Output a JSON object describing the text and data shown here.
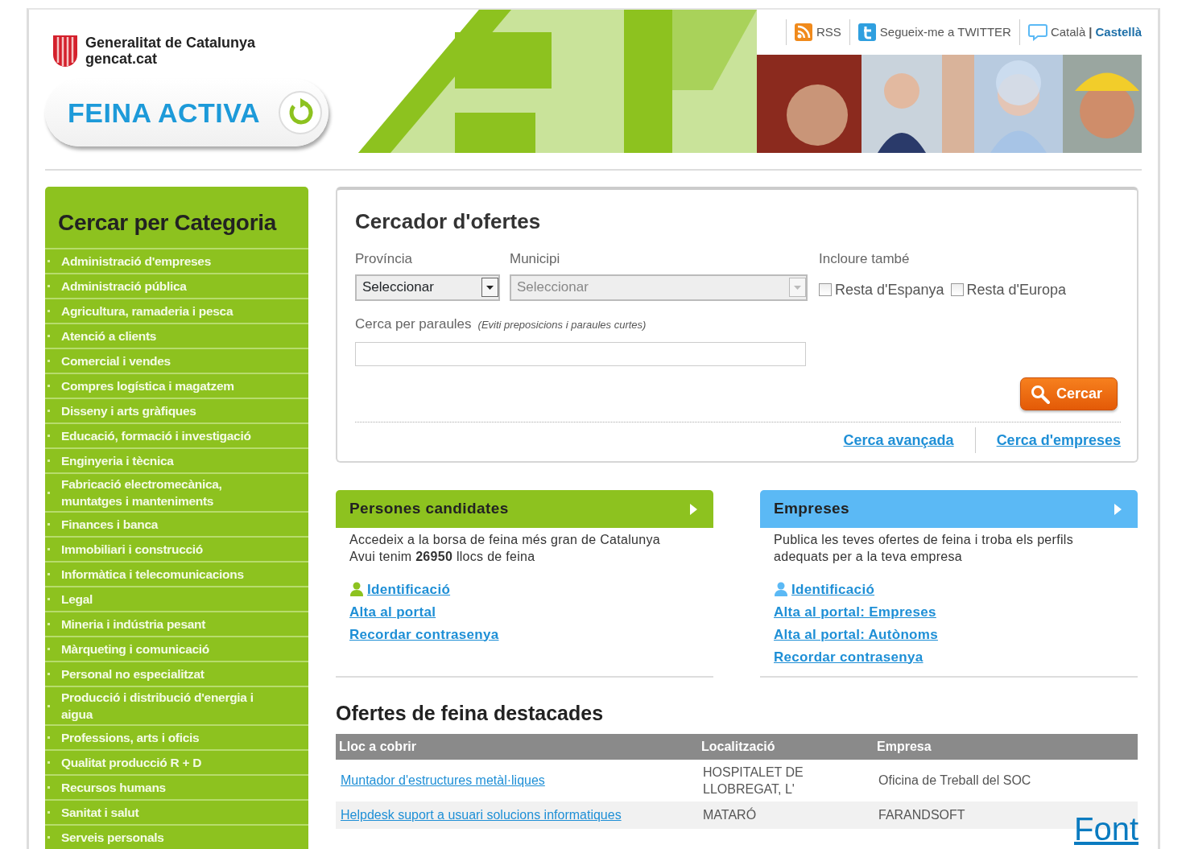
{
  "header": {
    "brand_name": "Generalitat de Catalunya",
    "brand_domain": "gencat.cat",
    "product": "FEINA ACTIVA",
    "links": [
      {
        "kind": "rss",
        "label": "RSS"
      },
      {
        "kind": "twitter",
        "label": "Segueix-me a TWITTER"
      }
    ],
    "languages": [
      {
        "label": "Català",
        "selected": false
      },
      {
        "label": "Castellà",
        "selected": true
      }
    ],
    "language_separator": "|"
  },
  "sidebar": {
    "title": "Cercar per Categoria",
    "items": [
      "Administració d'empreses",
      "Administració pública",
      "Agricultura, ramaderia i pesca",
      "Atenció a clients",
      "Comercial i vendes",
      "Compres logística i magatzem",
      "Disseny i arts gràfiques",
      "Educació, formació i investigació",
      "Enginyeria i tècnica",
      "Fabricació electromecànica, muntatges i manteniments",
      "Finances i banca",
      "Immobiliari i construcció",
      "Informàtica i telecomunicacions",
      "Legal",
      "Mineria i indústria pesant",
      "Màrqueting i comunicació",
      "Personal no especialitzat",
      "Producció i distribució d'energia i aigua",
      "Professions, arts i oficis",
      "Qualitat producció R + D",
      "Recursos humans",
      "Sanitat i salut",
      "Serveis personals"
    ]
  },
  "search": {
    "title": "Cercador d'ofertes",
    "selects": [
      {
        "label": "Província",
        "value": "Seleccionar",
        "disabled": false
      },
      {
        "label": "Municipi",
        "value": "Seleccionar",
        "disabled": true
      }
    ],
    "include_label": "Incloure també",
    "checkboxes": [
      {
        "label": "Resta d'Espanya",
        "checked": false
      },
      {
        "label": "Resta d'Europa",
        "checked": false
      }
    ],
    "keywords_label": "Cerca per paraules",
    "keywords_hint": "(Eviti preposicions i paraules curtes)",
    "button": "Cercar",
    "links": [
      "Cerca avançada",
      "Cerca d'empreses"
    ]
  },
  "panels": [
    {
      "title": "Persones candidates",
      "color": "#8dc21f",
      "lines": [
        "Accedeix a la borsa de feina més gran de Catalunya",
        "Avui tenim **26950** llocs de feina"
      ],
      "links": [
        {
          "kind": "login",
          "label": "Identificació"
        },
        {
          "kind": "plain",
          "label": "Alta al portal"
        },
        {
          "kind": "plain",
          "label": "Recordar contrasenya"
        }
      ]
    },
    {
      "title": "Empreses",
      "color": "#5bb9f5",
      "lines": [
        "Publica les teves ofertes de feina i troba els perfils adequats per a la teva empresa"
      ],
      "links": [
        {
          "kind": "login",
          "label": "Identificació"
        },
        {
          "kind": "plain",
          "label": "Alta al portal: Empreses"
        },
        {
          "kind": "plain",
          "label": "Alta al portal: Autònoms"
        },
        {
          "kind": "plain",
          "label": "Recordar contrasenya"
        }
      ]
    }
  ],
  "featured": {
    "title": "Ofertes de feina destacades",
    "columns": [
      "Lloc a cobrir",
      "Localització",
      "Empresa"
    ],
    "rows": [
      [
        "Muntador d'estructures metàl·liques",
        "HOSPITALET DE LLOBREGAT, L'",
        "Oficina de Treball del SOC"
      ],
      [
        "Helpdesk suport a usuari solucions informatiques",
        "MATARÓ",
        "FARANDSOFT"
      ]
    ]
  },
  "credit_link": "Font"
}
